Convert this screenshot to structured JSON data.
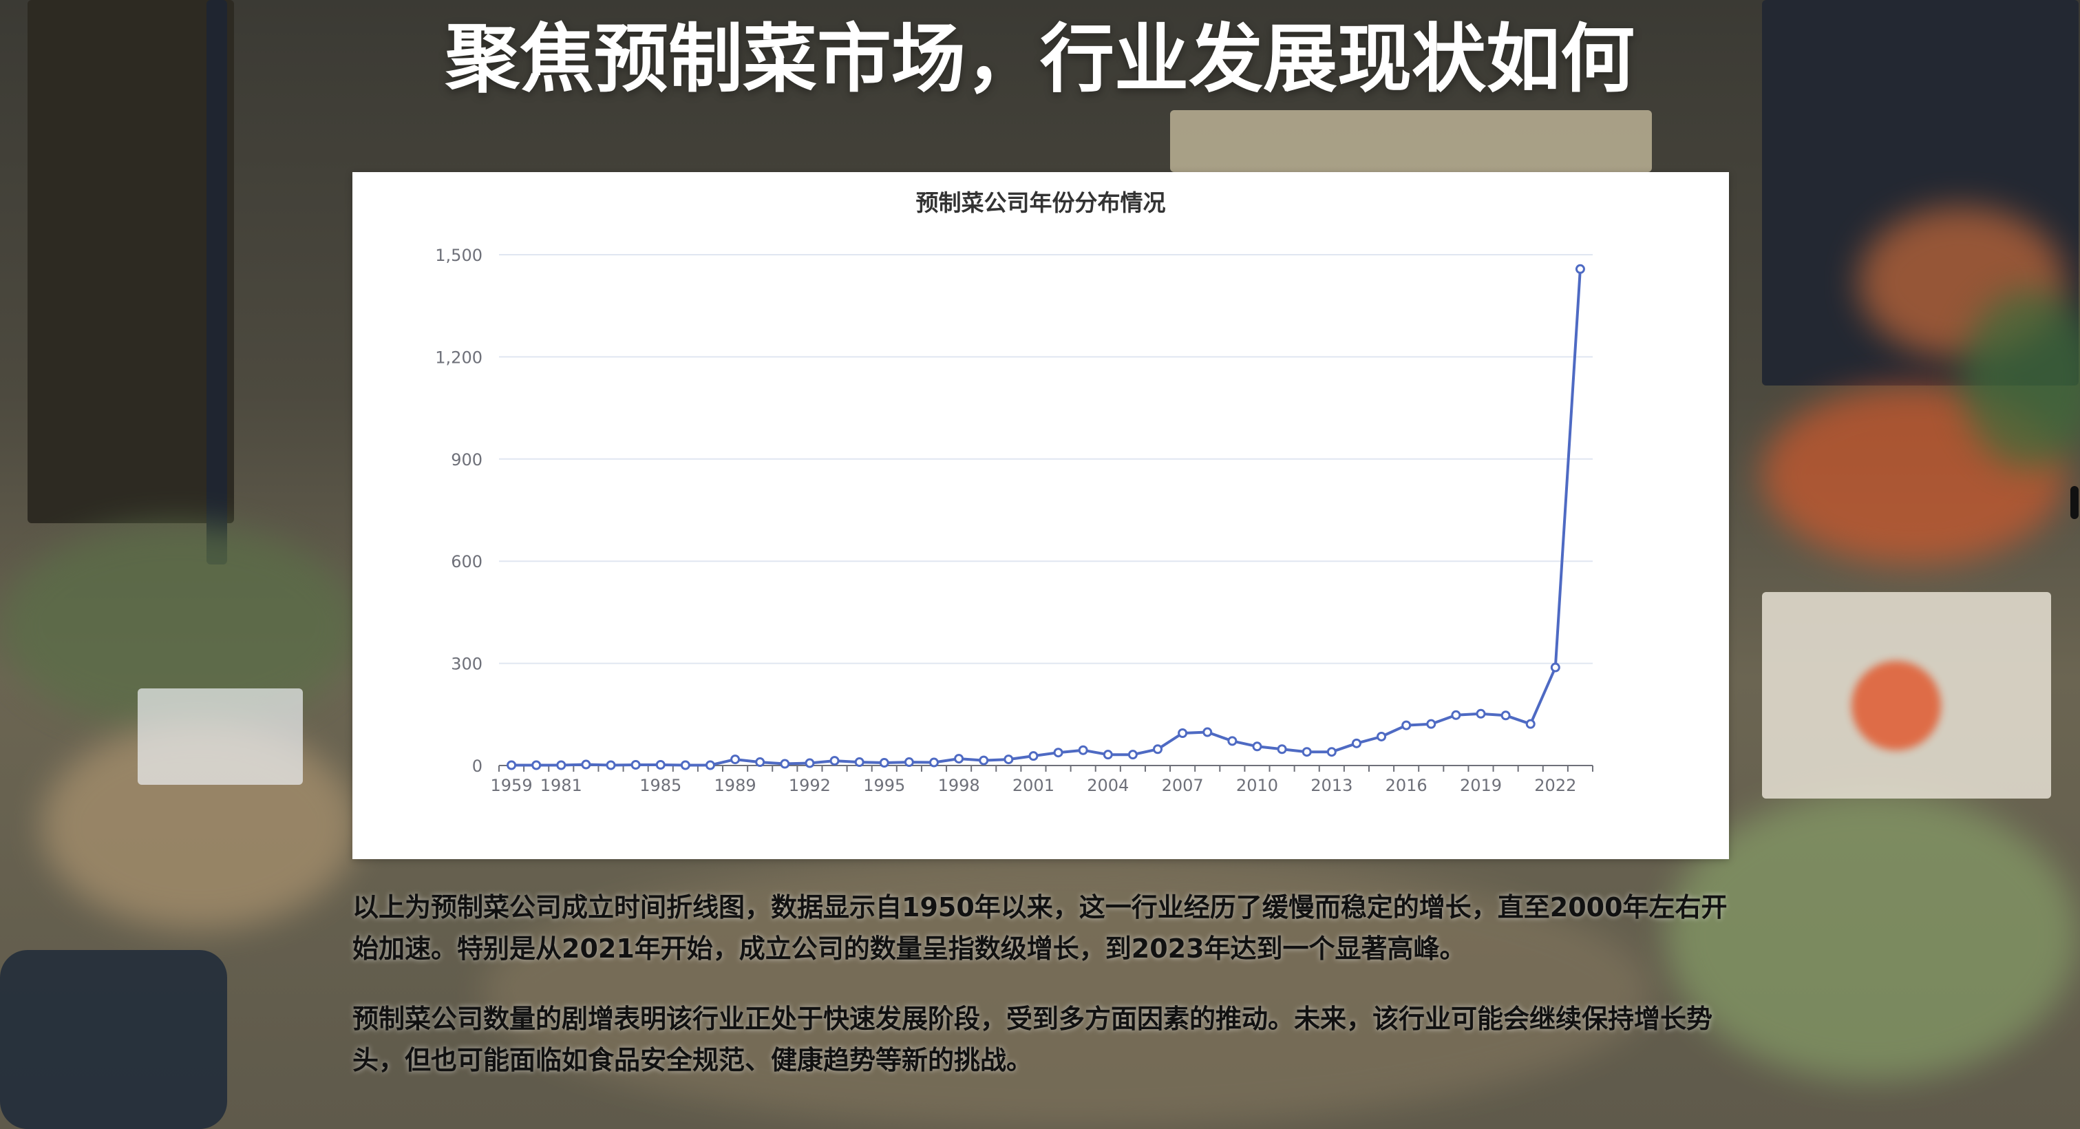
{
  "page": {
    "title": "聚焦预制菜市场，行业发展现状如何",
    "paragraph1": "以上为预制菜公司成立时间折线图，数据显示自1950年以来，这一行业经历了缓慢而稳定的增长，直至2000年左右开始加速。特别是从2021年开始，成立公司的数量呈指数级增长，到2023年达到一个显著高峰。",
    "paragraph2": "预制菜公司数量的剧增表明该行业正处于快速发展阶段，受到多方面因素的推动。未来，该行业可能会继续保持增长势头，但也可能面临如食品安全规范、健康趋势等新的挑战。"
  },
  "chart_data": {
    "type": "line",
    "title": "预制菜公司年份分布情况",
    "xlabel": "",
    "ylabel": "",
    "ylim": [
      0,
      1500
    ],
    "yticks": [
      "0",
      "300",
      "600",
      "900",
      "1,200",
      "1,500"
    ],
    "xticks": [
      "1959",
      "1981",
      "1985",
      "1989",
      "1992",
      "1995",
      "1998",
      "2001",
      "2004",
      "2007",
      "2010",
      "2013",
      "2016",
      "2019",
      "2022"
    ],
    "grid": true,
    "legend": "none",
    "color": "#4e6ac3",
    "categories": [
      "1959",
      "1980",
      "1981",
      "1982",
      "1983",
      "1984",
      "1985",
      "1986",
      "1987",
      "1989",
      "1990",
      "1991",
      "1992",
      "1993",
      "1994",
      "1995",
      "1996",
      "1997",
      "1998",
      "1999",
      "2000",
      "2001",
      "2002",
      "2003",
      "2004",
      "2005",
      "2006",
      "2007",
      "2008",
      "2009",
      "2010",
      "2011",
      "2012",
      "2013",
      "2014",
      "2015",
      "2016",
      "2017",
      "2018",
      "2019",
      "2020",
      "2021",
      "2022",
      "2023"
    ],
    "values": [
      1,
      1,
      1,
      3,
      1,
      2,
      2,
      1,
      1,
      18,
      10,
      5,
      7,
      14,
      10,
      8,
      10,
      9,
      20,
      15,
      18,
      28,
      38,
      45,
      32,
      32,
      48,
      95,
      98,
      72,
      56,
      48,
      40,
      40,
      65,
      85,
      118,
      122,
      148,
      152,
      147,
      122,
      288,
      1458
    ]
  }
}
